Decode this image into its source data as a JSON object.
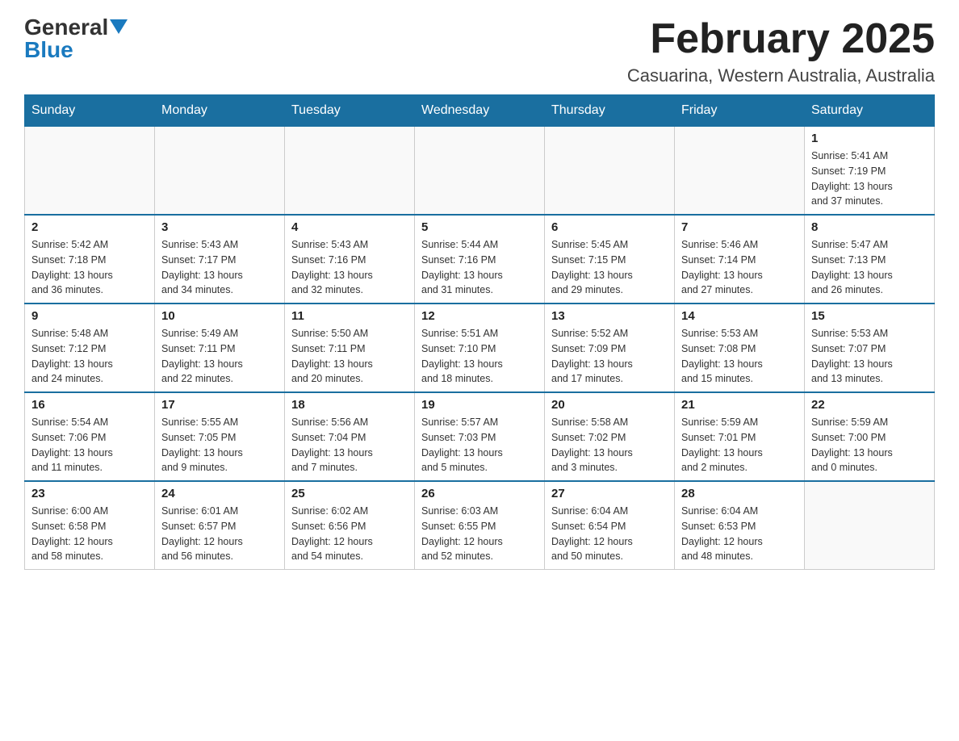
{
  "header": {
    "logo_general": "General",
    "logo_blue": "Blue",
    "month_title": "February 2025",
    "location": "Casuarina, Western Australia, Australia"
  },
  "weekdays": [
    "Sunday",
    "Monday",
    "Tuesday",
    "Wednesday",
    "Thursday",
    "Friday",
    "Saturday"
  ],
  "weeks": [
    [
      {
        "day": "",
        "info": ""
      },
      {
        "day": "",
        "info": ""
      },
      {
        "day": "",
        "info": ""
      },
      {
        "day": "",
        "info": ""
      },
      {
        "day": "",
        "info": ""
      },
      {
        "day": "",
        "info": ""
      },
      {
        "day": "1",
        "info": "Sunrise: 5:41 AM\nSunset: 7:19 PM\nDaylight: 13 hours\nand 37 minutes."
      }
    ],
    [
      {
        "day": "2",
        "info": "Sunrise: 5:42 AM\nSunset: 7:18 PM\nDaylight: 13 hours\nand 36 minutes."
      },
      {
        "day": "3",
        "info": "Sunrise: 5:43 AM\nSunset: 7:17 PM\nDaylight: 13 hours\nand 34 minutes."
      },
      {
        "day": "4",
        "info": "Sunrise: 5:43 AM\nSunset: 7:16 PM\nDaylight: 13 hours\nand 32 minutes."
      },
      {
        "day": "5",
        "info": "Sunrise: 5:44 AM\nSunset: 7:16 PM\nDaylight: 13 hours\nand 31 minutes."
      },
      {
        "day": "6",
        "info": "Sunrise: 5:45 AM\nSunset: 7:15 PM\nDaylight: 13 hours\nand 29 minutes."
      },
      {
        "day": "7",
        "info": "Sunrise: 5:46 AM\nSunset: 7:14 PM\nDaylight: 13 hours\nand 27 minutes."
      },
      {
        "day": "8",
        "info": "Sunrise: 5:47 AM\nSunset: 7:13 PM\nDaylight: 13 hours\nand 26 minutes."
      }
    ],
    [
      {
        "day": "9",
        "info": "Sunrise: 5:48 AM\nSunset: 7:12 PM\nDaylight: 13 hours\nand 24 minutes."
      },
      {
        "day": "10",
        "info": "Sunrise: 5:49 AM\nSunset: 7:11 PM\nDaylight: 13 hours\nand 22 minutes."
      },
      {
        "day": "11",
        "info": "Sunrise: 5:50 AM\nSunset: 7:11 PM\nDaylight: 13 hours\nand 20 minutes."
      },
      {
        "day": "12",
        "info": "Sunrise: 5:51 AM\nSunset: 7:10 PM\nDaylight: 13 hours\nand 18 minutes."
      },
      {
        "day": "13",
        "info": "Sunrise: 5:52 AM\nSunset: 7:09 PM\nDaylight: 13 hours\nand 17 minutes."
      },
      {
        "day": "14",
        "info": "Sunrise: 5:53 AM\nSunset: 7:08 PM\nDaylight: 13 hours\nand 15 minutes."
      },
      {
        "day": "15",
        "info": "Sunrise: 5:53 AM\nSunset: 7:07 PM\nDaylight: 13 hours\nand 13 minutes."
      }
    ],
    [
      {
        "day": "16",
        "info": "Sunrise: 5:54 AM\nSunset: 7:06 PM\nDaylight: 13 hours\nand 11 minutes."
      },
      {
        "day": "17",
        "info": "Sunrise: 5:55 AM\nSunset: 7:05 PM\nDaylight: 13 hours\nand 9 minutes."
      },
      {
        "day": "18",
        "info": "Sunrise: 5:56 AM\nSunset: 7:04 PM\nDaylight: 13 hours\nand 7 minutes."
      },
      {
        "day": "19",
        "info": "Sunrise: 5:57 AM\nSunset: 7:03 PM\nDaylight: 13 hours\nand 5 minutes."
      },
      {
        "day": "20",
        "info": "Sunrise: 5:58 AM\nSunset: 7:02 PM\nDaylight: 13 hours\nand 3 minutes."
      },
      {
        "day": "21",
        "info": "Sunrise: 5:59 AM\nSunset: 7:01 PM\nDaylight: 13 hours\nand 2 minutes."
      },
      {
        "day": "22",
        "info": "Sunrise: 5:59 AM\nSunset: 7:00 PM\nDaylight: 13 hours\nand 0 minutes."
      }
    ],
    [
      {
        "day": "23",
        "info": "Sunrise: 6:00 AM\nSunset: 6:58 PM\nDaylight: 12 hours\nand 58 minutes."
      },
      {
        "day": "24",
        "info": "Sunrise: 6:01 AM\nSunset: 6:57 PM\nDaylight: 12 hours\nand 56 minutes."
      },
      {
        "day": "25",
        "info": "Sunrise: 6:02 AM\nSunset: 6:56 PM\nDaylight: 12 hours\nand 54 minutes."
      },
      {
        "day": "26",
        "info": "Sunrise: 6:03 AM\nSunset: 6:55 PM\nDaylight: 12 hours\nand 52 minutes."
      },
      {
        "day": "27",
        "info": "Sunrise: 6:04 AM\nSunset: 6:54 PM\nDaylight: 12 hours\nand 50 minutes."
      },
      {
        "day": "28",
        "info": "Sunrise: 6:04 AM\nSunset: 6:53 PM\nDaylight: 12 hours\nand 48 minutes."
      },
      {
        "day": "",
        "info": ""
      }
    ]
  ]
}
